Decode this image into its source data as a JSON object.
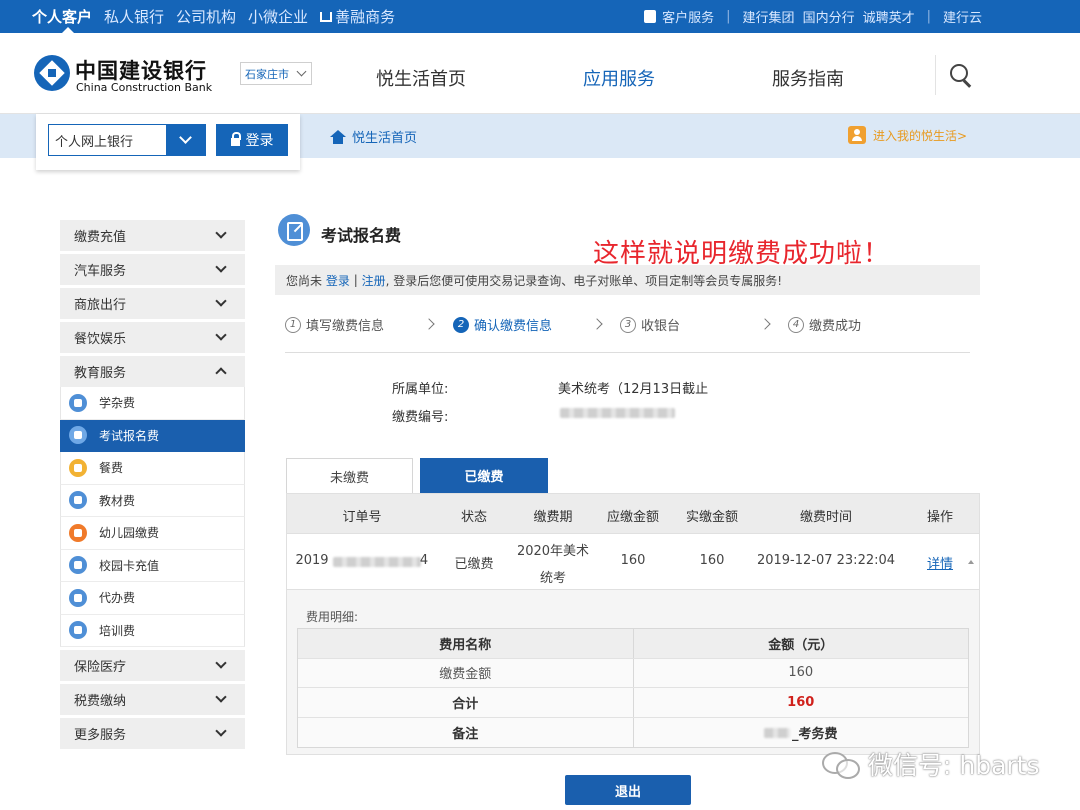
{
  "topbar": {
    "left_items": [
      "个人客户",
      "私人银行",
      "公司机构",
      "小微企业",
      "善融商务"
    ],
    "right_items": [
      "客户服务",
      "建行集团",
      "国内分行",
      "诚聘英才",
      "建行云"
    ]
  },
  "header": {
    "logo_cn": "中国建设银行",
    "logo_en": "China Construction Bank",
    "city": "石家庄市",
    "nav": [
      "悦生活首页",
      "应用服务",
      "服务指南"
    ]
  },
  "login": {
    "select_value": "个人网上银行",
    "button": "登录"
  },
  "subbar": {
    "home": "悦生活首页",
    "enter": "进入我的悦生活>"
  },
  "sidebar": {
    "cats_top": [
      "缴费充值",
      "汽车服务",
      "商旅出行",
      "餐饮娱乐",
      "教育服务"
    ],
    "subs": [
      {
        "label": "学杂费",
        "color": "#4f8fd6"
      },
      {
        "label": "考试报名费",
        "color": "#6fa8e6"
      },
      {
        "label": "餐费",
        "color": "#f2b233"
      },
      {
        "label": "教材费",
        "color": "#4f8fd6"
      },
      {
        "label": "幼儿园缴费",
        "color": "#f07a2a"
      },
      {
        "label": "校园卡充值",
        "color": "#4f8fd6"
      },
      {
        "label": "代办费",
        "color": "#4f8fd6"
      },
      {
        "label": "培训费",
        "color": "#4f8fd6"
      }
    ],
    "cats_bottom": [
      "保险医疗",
      "税费缴纳",
      "更多服务"
    ]
  },
  "main": {
    "title": "考试报名费",
    "annotation": "这样就说明缴费成功啦！",
    "notice_pre": "您尚未",
    "notice_login": "登录",
    "notice_sep": "|",
    "notice_register": "注册",
    "notice_post": ", 登录后您便可使用交易记录查询、电子对账单、项目定制等会员专属服务!",
    "steps": [
      {
        "num": "1",
        "label": "填写缴费信息"
      },
      {
        "num": "2",
        "label": "确认缴费信息"
      },
      {
        "num": "3",
        "label": "收银台"
      },
      {
        "num": "4",
        "label": "缴费成功"
      }
    ],
    "field1_label": "所属单位:",
    "field1_value": "美术统考（12月13日截止",
    "field2_label": "缴费编号:",
    "tab_unpaid": "未缴费",
    "tab_paid": "已缴费",
    "table": {
      "headers": [
        "订单号",
        "状态",
        "缴费期",
        "应缴金额",
        "实缴金额",
        "缴费时间",
        "操作"
      ],
      "row": {
        "order_prefix": "2019",
        "order_suffix": "4",
        "status": "已缴费",
        "period_line1": "2020年美术",
        "period_line2": "统考",
        "due": "160",
        "paid": "160",
        "time": "2019-12-07 23:22:04",
        "action": "详情"
      }
    },
    "detail": {
      "label": "费用明细:",
      "headers": [
        "费用名称",
        "金额（元）"
      ],
      "rows": [
        [
          "缴费金额",
          "160"
        ],
        [
          "合计",
          "160"
        ],
        [
          "备注",
          "_考务费"
        ]
      ]
    },
    "exit": "退出"
  },
  "watermark": "微信号: hbarts"
}
